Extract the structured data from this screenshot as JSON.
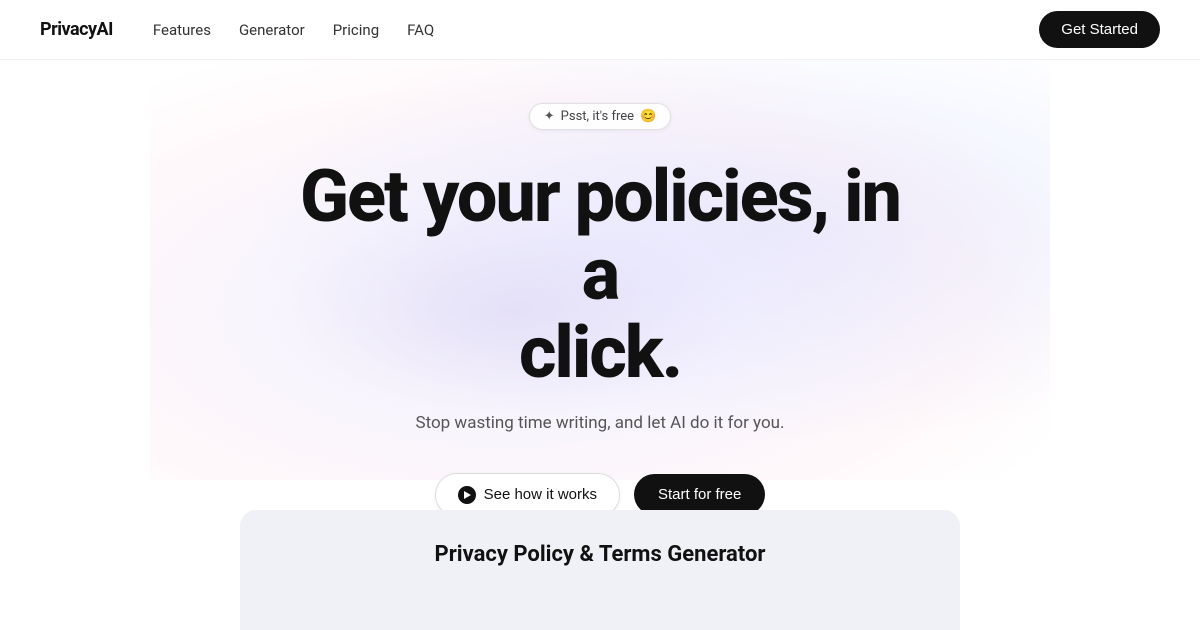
{
  "navbar": {
    "logo": "PrivacyAI",
    "nav_items": [
      {
        "label": "Features",
        "id": "features"
      },
      {
        "label": "Generator",
        "id": "generator"
      },
      {
        "label": "Pricing",
        "id": "pricing"
      },
      {
        "label": "FAQ",
        "id": "faq"
      }
    ],
    "cta_label": "Get Started"
  },
  "hero": {
    "badge_icon": "✦",
    "badge_text": "Psst, it's free",
    "badge_emoji": "😊",
    "title_line1": "Get your policies, in a",
    "title_line2": "click.",
    "subtitle": "Stop wasting time writing, and let AI do it for you.",
    "see_how_label": "See how it works",
    "start_free_label": "Start for free"
  },
  "generator_section": {
    "title": "Privacy Policy & Terms Generator"
  }
}
